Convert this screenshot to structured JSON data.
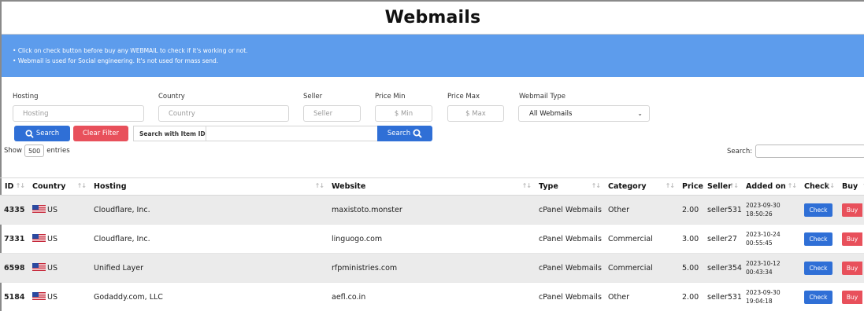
{
  "page": {
    "title": "Webmails"
  },
  "notice": {
    "lines": [
      "Click on check button before buy any WEBMAIL to check if it's working or not.",
      "Webmail is used for Social engineering. It's not used for mass send."
    ]
  },
  "filters": {
    "hosting": {
      "label": "Hosting",
      "placeholder": "Hosting"
    },
    "country": {
      "label": "Country",
      "placeholder": "Country"
    },
    "seller": {
      "label": "Seller",
      "placeholder": "Seller"
    },
    "price_min": {
      "label": "Price Min",
      "placeholder": "$ Min"
    },
    "price_max": {
      "label": "Price Max",
      "placeholder": "$ Max"
    },
    "webmail_type": {
      "label": "Webmail Type",
      "value": "All Webmails"
    },
    "search_button": "Search",
    "clear_button": "Clear Filter",
    "id_search_label": "Search with Item ID",
    "id_search_button": "Search"
  },
  "table_controls": {
    "show_prefix": "Show",
    "page_size": "500",
    "show_suffix": "entries",
    "search_label": "Search:"
  },
  "table": {
    "columns": [
      "ID",
      "Country",
      "Hosting",
      "Website",
      "Type",
      "Category",
      "Price",
      "Seller",
      "Added on",
      "Check",
      "Buy"
    ],
    "rows": [
      {
        "id": "4335",
        "country": "US",
        "hosting": "Cloudflare, Inc.",
        "website": "maxistoto.monster",
        "type": "cPanel Webmails",
        "category": "Other",
        "price": "2.00",
        "seller": "seller531",
        "date": "2023-09-30",
        "time": "18:50:26",
        "check": "Check",
        "buy": "Buy"
      },
      {
        "id": "7331",
        "country": "US",
        "hosting": "Cloudflare, Inc.",
        "website": "linguogo.com",
        "type": "cPanel Webmails",
        "category": "Commercial",
        "price": "3.00",
        "seller": "seller27",
        "date": "2023-10-24",
        "time": "00:55:45",
        "check": "Check",
        "buy": "Buy"
      },
      {
        "id": "6598",
        "country": "US",
        "hosting": "Unified Layer",
        "website": "rfpministries.com",
        "type": "cPanel Webmails",
        "category": "Commercial",
        "price": "5.00",
        "seller": "seller354",
        "date": "2023-10-12",
        "time": "00:43:34",
        "check": "Check",
        "buy": "Buy"
      },
      {
        "id": "5184",
        "country": "US",
        "hosting": "Godaddy.com, LLC",
        "website": "aefl.co.in",
        "type": "cPanel Webmails",
        "category": "Other",
        "price": "2.00",
        "seller": "seller531",
        "date": "2023-09-30",
        "time": "19:04:18",
        "check": "Check",
        "buy": "Buy"
      }
    ]
  },
  "colors": {
    "banner": "#5d9cec",
    "primary": "#2f6fd6",
    "danger": "#e8505b",
    "row_stripe": "#ebebeb"
  }
}
